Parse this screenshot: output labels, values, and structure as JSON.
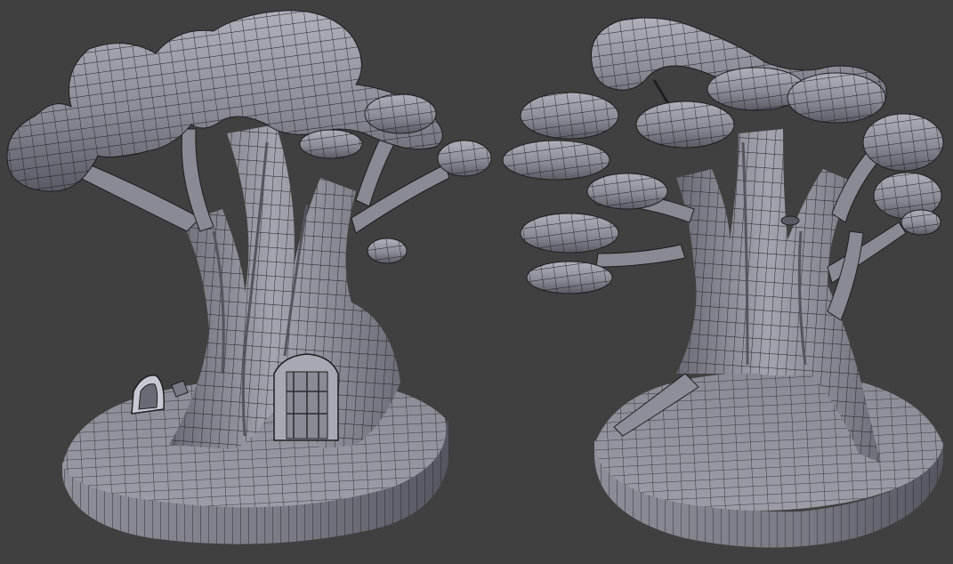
{
  "scene": {
    "background_color": "#404040",
    "mesh_color": "#8e8e98",
    "mesh_shadow_color": "#5e5e68",
    "mesh_highlight_color": "#b6b6c0",
    "wire_color": "#1c1c1c",
    "models": [
      {
        "name": "tree-house-front-view",
        "features": [
          "trunk",
          "canopy",
          "branches",
          "door",
          "window",
          "round-base"
        ]
      },
      {
        "name": "tree-house-back-view",
        "features": [
          "trunk",
          "canopy",
          "branches",
          "round-base"
        ]
      }
    ]
  }
}
